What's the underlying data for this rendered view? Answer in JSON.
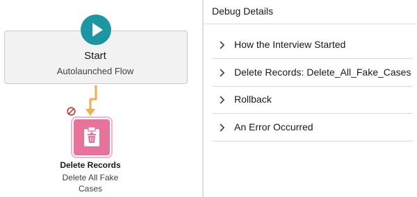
{
  "canvas": {
    "start": {
      "title": "Start",
      "subtitle": "Autolaunched Flow",
      "icon": "play-icon"
    },
    "element": {
      "title": "Delete Records",
      "subtitle_line1": "Delete All Fake",
      "subtitle_line2": "Cases",
      "icon": "delete-records-icon",
      "warning_icon": "no-entry-icon"
    }
  },
  "debug_panel": {
    "title": "Debug Details",
    "sections": [
      {
        "label": "How the Interview Started"
      },
      {
        "label": "Delete Records: Delete_All_Fake_Cases"
      },
      {
        "label": "Rollback"
      },
      {
        "label": "An Error Occurred"
      }
    ]
  },
  "colors": {
    "start_circle": "#1b96a3",
    "delete_element": "#e8739a",
    "connector": "#f4ad4a",
    "no_entry": "#c23934"
  }
}
